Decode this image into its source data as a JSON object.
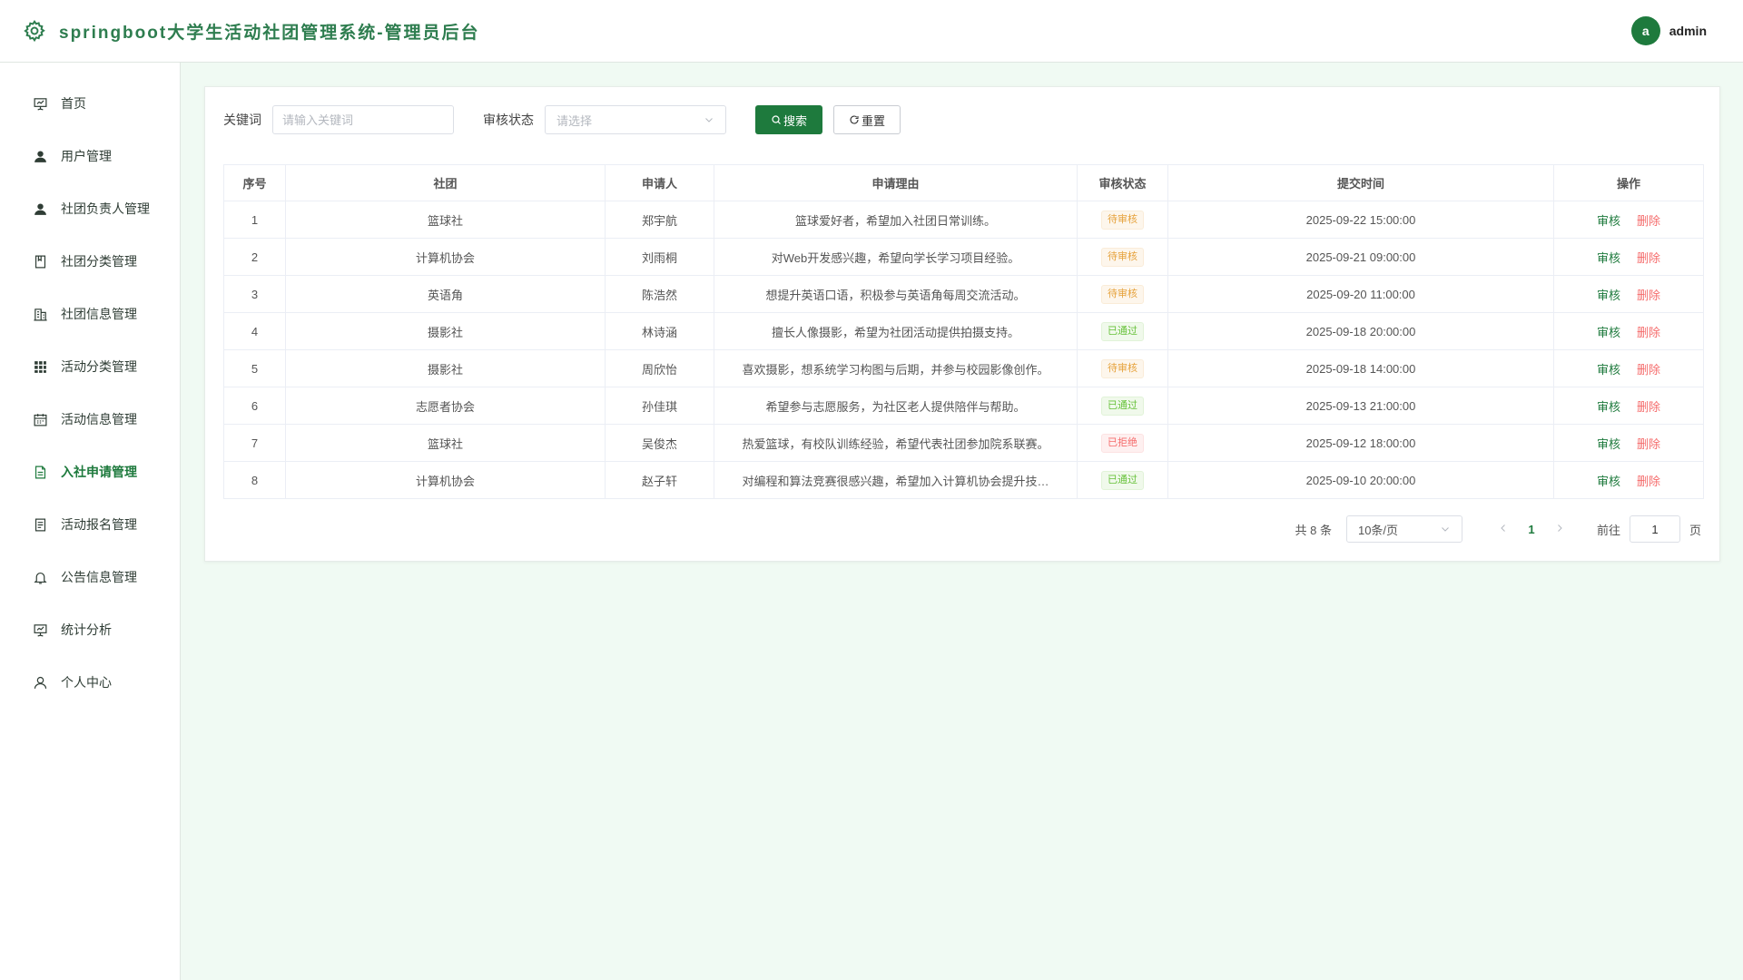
{
  "header": {
    "title": "springboot大学生活动社团管理系统-管理员后台",
    "avatar_letter": "a",
    "username": "admin"
  },
  "sidebar": {
    "items": [
      {
        "label": "首页",
        "icon": "presentation-icon"
      },
      {
        "label": "用户管理",
        "icon": "user-solid-icon"
      },
      {
        "label": "社团负责人管理",
        "icon": "user-solid-icon"
      },
      {
        "label": "社团分类管理",
        "icon": "notebook-icon"
      },
      {
        "label": "社团信息管理",
        "icon": "office-building-icon"
      },
      {
        "label": "活动分类管理",
        "icon": "grid-icon"
      },
      {
        "label": "活动信息管理",
        "icon": "calendar-icon"
      },
      {
        "label": "入社申请管理",
        "icon": "document-icon",
        "active": true
      },
      {
        "label": "活动报名管理",
        "icon": "tickets-icon"
      },
      {
        "label": "公告信息管理",
        "icon": "bell-icon"
      },
      {
        "label": "统计分析",
        "icon": "presentation-icon"
      },
      {
        "label": "个人中心",
        "icon": "user-icon"
      }
    ]
  },
  "filters": {
    "keyword_label": "关键词",
    "keyword_placeholder": "请输入关键词",
    "status_label": "审核状态",
    "status_placeholder": "请选择",
    "search_label": "搜索",
    "reset_label": "重置"
  },
  "table": {
    "columns": [
      "序号",
      "社团",
      "申请人",
      "申请理由",
      "审核状态",
      "提交时间",
      "操作"
    ],
    "rows": [
      {
        "no": "1",
        "club": "篮球社",
        "applicant": "郑宇航",
        "reason": "篮球爱好者，希望加入社团日常训练。",
        "status": "待审核",
        "status_type": "pending",
        "time": "2025-09-22 15:00:00"
      },
      {
        "no": "2",
        "club": "计算机协会",
        "applicant": "刘雨桐",
        "reason": "对Web开发感兴趣，希望向学长学习项目经验。",
        "status": "待审核",
        "status_type": "pending",
        "time": "2025-09-21 09:00:00"
      },
      {
        "no": "3",
        "club": "英语角",
        "applicant": "陈浩然",
        "reason": "想提升英语口语，积极参与英语角每周交流活动。",
        "status": "待审核",
        "status_type": "pending",
        "time": "2025-09-20 11:00:00"
      },
      {
        "no": "4",
        "club": "摄影社",
        "applicant": "林诗涵",
        "reason": "擅长人像摄影，希望为社团活动提供拍摄支持。",
        "status": "已通过",
        "status_type": "approved",
        "time": "2025-09-18 20:00:00"
      },
      {
        "no": "5",
        "club": "摄影社",
        "applicant": "周欣怡",
        "reason": "喜欢摄影，想系统学习构图与后期，并参与校园影像创作。",
        "status": "待审核",
        "status_type": "pending",
        "time": "2025-09-18 14:00:00"
      },
      {
        "no": "6",
        "club": "志愿者协会",
        "applicant": "孙佳琪",
        "reason": "希望参与志愿服务，为社区老人提供陪伴与帮助。",
        "status": "已通过",
        "status_type": "approved",
        "time": "2025-09-13 21:00:00"
      },
      {
        "no": "7",
        "club": "篮球社",
        "applicant": "吴俊杰",
        "reason": "热爱篮球，有校队训练经验，希望代表社团参加院系联赛。",
        "status": "已拒绝",
        "status_type": "rejected",
        "time": "2025-09-12 18:00:00"
      },
      {
        "no": "8",
        "club": "计算机协会",
        "applicant": "赵子轩",
        "reason": "对编程和算法竞赛很感兴趣，希望加入计算机协会提升技…",
        "status": "已通过",
        "status_type": "approved",
        "time": "2025-09-10 20:00:00"
      }
    ],
    "review_label": "审核",
    "delete_label": "删除"
  },
  "pagination": {
    "total": "共 8 条",
    "page_size": "10条/页",
    "current_page": "1",
    "goto_label": "前往",
    "goto_value": "1",
    "page_unit": "页"
  },
  "colors": {
    "accent": "#1e7a3d",
    "title": "#2e7d4f",
    "background": "#f0faf3",
    "danger": "#f56c6c"
  }
}
